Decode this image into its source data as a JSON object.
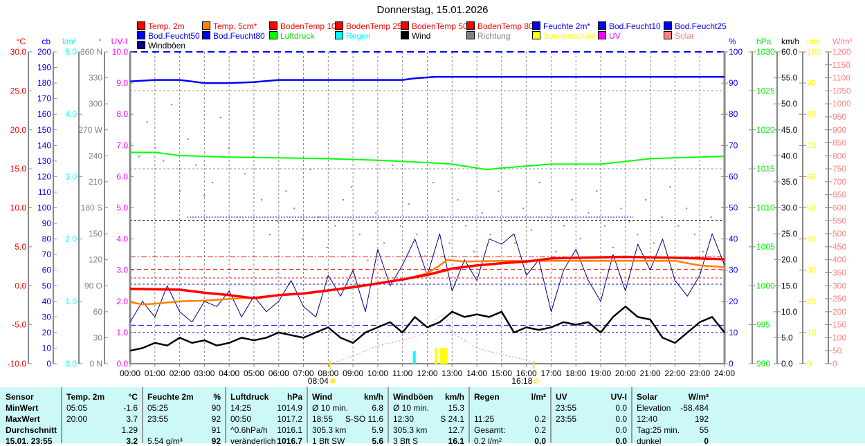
{
  "title": "Donnerstag, 15.01.2026",
  "legend": [
    {
      "label": "Temp. 2m",
      "color": "#ff0000",
      "text": "#ff0000"
    },
    {
      "label": "Temp. 5cm*",
      "color": "#ff8000",
      "text": "#ff0000"
    },
    {
      "label": "BodenTemp 10",
      "color": "#ff0000",
      "text": "#ff0000"
    },
    {
      "label": "BodenTemp 25",
      "color": "#ff0000",
      "text": "#ff0000"
    },
    {
      "label": "BodenTemp 50",
      "color": "#ff0000",
      "text": "#ff0000"
    },
    {
      "label": "BodenTemp 80",
      "color": "#ff0000",
      "text": "#ff0000"
    },
    {
      "label": "Feuchte 2m*",
      "color": "#0000ff",
      "text": "#0000ff"
    },
    {
      "label": "Bod.Feucht10",
      "color": "#0000ff",
      "text": "#0000ff"
    },
    {
      "label": "Bod.Feucht25",
      "color": "#0000ff",
      "text": "#0000ff"
    },
    {
      "label": "Bod.Feucht50",
      "color": "#0000ff",
      "text": "#0000ff"
    },
    {
      "label": "Bod.Feucht80",
      "color": "#0000ff",
      "text": "#0000ff"
    },
    {
      "label": "Luftdruck",
      "color": "#00ff00",
      "text": "#00dd00"
    },
    {
      "label": "Regen",
      "color": "#00ffff",
      "text": "#00ffff"
    },
    {
      "label": "Wind",
      "color": "#000000",
      "text": "#000000"
    },
    {
      "label": "Richtung",
      "color": "#808080",
      "text": "#808080"
    },
    {
      "label": "Sonnenschein",
      "color": "#ffff00",
      "text": "#ffff00"
    },
    {
      "label": "UV",
      "color": "#ff00ff",
      "text": "#ff00ff"
    },
    {
      "label": "Solar",
      "color": "#ff8080",
      "text": "#ff8080"
    },
    {
      "label": "Windböen",
      "color": "#000080",
      "text": "#000000"
    }
  ],
  "chart_data": {
    "type": "line",
    "title": "Donnerstag, 15.01.2026",
    "x_labels": [
      "00:00",
      "01:00",
      "02:00",
      "03:00",
      "04:00",
      "05:00",
      "06:00",
      "07:00",
      "08:00",
      "09:00",
      "10:00",
      "11:00",
      "12:00",
      "13:00",
      "14:00",
      "15:00",
      "16:00",
      "17:00",
      "18:00",
      "19:00",
      "20:00",
      "21:00",
      "22:00",
      "23:00",
      "24:00"
    ],
    "sunrise": "08:04",
    "sunset": "16:18",
    "sunrise_h": 8.07,
    "sunset_h": 16.3,
    "axes": {
      "left": [
        {
          "unit": "°C",
          "color": "#ff0000",
          "min": -10,
          "max": 30,
          "labels": [
            "30.0",
            "25.0",
            "20.0",
            "15.0",
            "10.0",
            "5.0",
            "0.0",
            "-5.0",
            "-10.0"
          ]
        },
        {
          "unit": "cb",
          "color": "#0000ff",
          "min": 0,
          "max": 200,
          "labels": [
            "200",
            "190",
            "180",
            "170",
            "160",
            "150",
            "140",
            "130",
            "120",
            "110",
            "100",
            "90",
            "80",
            "70",
            "60",
            "50",
            "40",
            "30",
            "20",
            "10",
            "0"
          ]
        },
        {
          "unit": "l/m²",
          "color": "#00ffff",
          "min": 0,
          "max": 5,
          "labels": [
            "5.0",
            "4.0",
            "3.0",
            "2.0",
            "1.0",
            "0.0"
          ]
        },
        {
          "unit": "°",
          "color": "#808080",
          "min": 0,
          "max": 360,
          "labels": [
            "360 N",
            "330",
            "300",
            "270 W",
            "240",
            "210",
            "180 S",
            "150",
            "120",
            "90 O",
            "60",
            "30",
            "0 N"
          ]
        },
        {
          "unit": "UV-I",
          "color": "#ff00ff",
          "min": 0,
          "max": 10,
          "labels": [
            "10.0",
            "9.0",
            "8.0",
            "7.0",
            "6.0",
            "5.0",
            "4.0",
            "3.0",
            "2.0",
            "1.0",
            "0.0"
          ]
        }
      ],
      "right": [
        {
          "unit": "%",
          "color": "#0000ff",
          "min": 0,
          "max": 100,
          "labels": [
            "100",
            "90",
            "80",
            "70",
            "60",
            "50",
            "40",
            "30",
            "20",
            "10",
            "0"
          ]
        },
        {
          "unit": "hPa",
          "color": "#00ee00",
          "min": 990,
          "max": 1030,
          "labels": [
            "1030",
            "1025",
            "1020",
            "1015",
            "1010",
            "1005",
            "1000",
            "995",
            "990"
          ]
        },
        {
          "unit": "km/h",
          "color": "#000000",
          "min": 0,
          "max": 60,
          "labels": [
            "60.0",
            "55.0",
            "50.0",
            "45.0",
            "40.0",
            "35.0",
            "30.0",
            "25.0",
            "20.0",
            "15.0",
            "10.0",
            "5.0",
            "0.0"
          ]
        },
        {
          "unit": "min",
          "color": "#ffff00",
          "min": 0,
          "max": 100,
          "labels": [
            "100",
            "90",
            "80",
            "70",
            "60",
            "50",
            "40",
            "30",
            "20",
            "10",
            "0"
          ]
        },
        {
          "unit": "W/m²",
          "color": "#ff8080",
          "min": 0,
          "max": 1200,
          "labels": [
            "1200",
            "1150",
            "1100",
            "1050",
            "1000",
            "950",
            "900",
            "850",
            "800",
            "750",
            "700",
            "650",
            "600",
            "550",
            "500",
            "450",
            "400",
            "350",
            "300",
            "250",
            "200",
            "150",
            "100",
            "50",
            "0"
          ]
        }
      ]
    },
    "series": [
      {
        "name": "Luftdruck",
        "axis": "hPa",
        "color": "#00ff00",
        "width": 2,
        "points": [
          [
            0,
            1017.1
          ],
          [
            1,
            1017.1
          ],
          [
            2,
            1016.7
          ],
          [
            3,
            1016.6
          ],
          [
            4,
            1016.5
          ],
          [
            6,
            1016.4
          ],
          [
            8,
            1016.3
          ],
          [
            10,
            1016.1
          ],
          [
            12,
            1015.8
          ],
          [
            13,
            1015.6
          ],
          [
            14.4,
            1014.9
          ],
          [
            15,
            1015.1
          ],
          [
            17,
            1015.6
          ],
          [
            19,
            1015.6
          ],
          [
            21,
            1016.3
          ],
          [
            22,
            1016.4
          ],
          [
            24,
            1016.6
          ]
        ]
      },
      {
        "name": "Feuchte 2m",
        "axis": "%",
        "color": "#0000ff",
        "width": 2.5,
        "points": [
          [
            0,
            90.5
          ],
          [
            1,
            91
          ],
          [
            2,
            91
          ],
          [
            3,
            90
          ],
          [
            4,
            90
          ],
          [
            5,
            90.3
          ],
          [
            6,
            91
          ],
          [
            10,
            91
          ],
          [
            11,
            91
          ],
          [
            11.5,
            91.5
          ],
          [
            12.3,
            92
          ],
          [
            24,
            92
          ]
        ]
      },
      {
        "name": "Windböen",
        "axis": "km/h",
        "color": "#000080",
        "width": 1,
        "step": 0.5,
        "values": [
          8,
          12,
          9,
          15,
          10,
          8,
          12,
          11,
          14,
          9,
          13,
          10,
          12,
          16,
          11,
          9,
          17,
          13,
          18,
          10,
          22,
          15,
          19,
          24,
          17,
          25,
          14,
          20,
          16,
          24,
          23,
          25,
          17,
          20,
          10,
          18,
          22,
          16,
          12,
          21,
          14,
          23,
          18,
          24,
          16,
          13,
          17,
          25,
          19
        ]
      },
      {
        "name": "Wind",
        "axis": "km/h",
        "color": "#000000",
        "width": 2.5,
        "step": 0.5,
        "values": [
          2.5,
          3,
          4,
          3.5,
          5,
          4,
          4.5,
          3.5,
          4,
          5,
          4.5,
          5,
          6,
          5.5,
          5,
          6,
          7,
          5,
          4,
          6,
          7,
          8,
          6,
          9,
          7,
          8,
          10,
          9,
          9.5,
          9,
          10,
          6,
          7,
          6.5,
          7,
          8,
          7.5,
          8,
          6,
          9,
          11,
          9,
          8.5,
          5,
          4,
          6,
          8,
          9,
          6
        ]
      },
      {
        "name": "Temp. 5cm",
        "axis": "°C",
        "color": "#ff8000",
        "width": 2.5,
        "points": [
          [
            0,
            -2.1
          ],
          [
            0.5,
            -2.4
          ],
          [
            1,
            -2.3
          ],
          [
            2,
            -2.0
          ],
          [
            3,
            -1.9
          ],
          [
            4,
            -1.7
          ],
          [
            5,
            -1.5
          ],
          [
            6,
            -1.2
          ],
          [
            7,
            -1.0
          ],
          [
            8,
            -0.6
          ],
          [
            9,
            -0.1
          ],
          [
            10,
            0.3
          ],
          [
            11,
            0.8
          ],
          [
            12,
            1.6
          ],
          [
            12.5,
            2.6
          ],
          [
            12.8,
            3.3
          ],
          [
            13.5,
            3.1
          ],
          [
            15,
            3.2
          ],
          [
            18,
            3.2
          ],
          [
            20,
            3.2
          ],
          [
            22,
            3.2
          ],
          [
            22.5,
            2.9
          ],
          [
            23,
            2.6
          ],
          [
            24,
            2.4
          ]
        ]
      },
      {
        "name": "Temp. 2m",
        "axis": "°C",
        "color": "#ff0000",
        "width": 3.5,
        "points": [
          [
            0,
            -0.4
          ],
          [
            2,
            -0.5
          ],
          [
            3,
            -0.9
          ],
          [
            4,
            -1.2
          ],
          [
            5,
            -1.6
          ],
          [
            6,
            -1.2
          ],
          [
            7,
            -1.0
          ],
          [
            8,
            -0.6
          ],
          [
            9,
            -0.2
          ],
          [
            10,
            0.3
          ],
          [
            11,
            0.8
          ],
          [
            12,
            1.4
          ],
          [
            12.5,
            1.8
          ],
          [
            13,
            2.2
          ],
          [
            14,
            2.6
          ],
          [
            15,
            2.9
          ],
          [
            16,
            3.1
          ],
          [
            17,
            3.5
          ],
          [
            18,
            3.6
          ],
          [
            20,
            3.7
          ],
          [
            22,
            3.6
          ],
          [
            23,
            3.5
          ],
          [
            24,
            3.4
          ]
        ]
      }
    ],
    "solar": {
      "axis": "W/m²",
      "color": "#ff8080",
      "points": [
        [
          8.07,
          0
        ],
        [
          9,
          30
        ],
        [
          10,
          70
        ],
        [
          11,
          90
        ],
        [
          12,
          120
        ],
        [
          12.3,
          170
        ],
        [
          12.67,
          192
        ],
        [
          13,
          120
        ],
        [
          14,
          60
        ],
        [
          15,
          35
        ],
        [
          16,
          15
        ],
        [
          16.3,
          0
        ]
      ]
    },
    "sunshine": {
      "axis": "min",
      "color": "#ffff00",
      "points": [
        [
          12.3,
          5
        ],
        [
          12.5,
          5
        ],
        [
          12.6,
          5
        ],
        [
          12.7,
          5
        ]
      ]
    },
    "rain": {
      "axis": "l/m²",
      "color": "#00ffff",
      "points": [
        [
          11.42,
          0.2
        ]
      ]
    },
    "direction": {
      "axis": "°",
      "color": "#808080",
      "step": 0.33,
      "values": [
        255,
        240,
        280,
        250,
        235,
        300,
        200,
        260,
        230,
        195,
        210,
        285,
        250,
        170,
        220,
        240,
        190,
        150,
        165,
        200,
        180,
        145,
        225,
        170,
        135,
        160,
        190,
        205,
        150,
        120,
        175,
        140,
        230,
        160,
        185,
        150,
        125,
        210,
        170,
        140,
        190,
        160,
        130,
        175,
        150,
        200,
        165,
        140,
        180,
        155,
        210,
        170,
        130,
        160,
        190,
        145,
        175,
        200,
        160,
        135,
        180,
        165,
        150,
        190,
        140,
        170,
        205,
        160,
        180,
        150,
        130,
        170
      ]
    },
    "reference_lines": [
      {
        "axis": "%",
        "value": 87.5,
        "color": "#808080",
        "dash": "3,3"
      },
      {
        "axis": "%",
        "value": 62.5,
        "color": "#808080",
        "dash": "3,3"
      },
      {
        "axis": "%",
        "value": 46,
        "color": "#000000",
        "dash": "3,3"
      },
      {
        "axis": "°C",
        "value": 3.7,
        "color": "#ff0000",
        "dash": "8,3,2,3"
      },
      {
        "axis": "°C",
        "value": 2.1,
        "color": "#ff0000",
        "dash": "6,4"
      },
      {
        "axis": "°C",
        "value": 1.0,
        "color": "#ff0000",
        "dash": "3,3"
      },
      {
        "axis": "km/h",
        "value": 15.3,
        "color": "#0000ff",
        "dash": "3,3"
      },
      {
        "axis": "km/h",
        "value": 7.4,
        "color": "#0000ff",
        "dash": "8,4"
      },
      {
        "axis": "km/h",
        "value": 6.0,
        "color": "#0000ff",
        "dash": "3,3"
      },
      {
        "axis": "%",
        "value": 100,
        "color": "#0000ff",
        "dash": "10,6"
      }
    ]
  },
  "table": [
    {
      "h": [
        "Sensor",
        ""
      ],
      "rows": [
        [
          "MinWert",
          ""
        ],
        [
          "MaxWert",
          ""
        ],
        [
          "Durchschnitt",
          ""
        ],
        [
          "15.01. 23:55",
          ""
        ]
      ],
      "bold": true
    },
    {
      "h": [
        "Temp. 2m",
        "°C"
      ],
      "rows": [
        [
          "05:05",
          "-1.6"
        ],
        [
          "20:00",
          "3.7"
        ],
        [
          "",
          "1.29"
        ],
        [
          "",
          "3.2"
        ]
      ]
    },
    {
      "h": [
        "Feuchte 2m",
        "%"
      ],
      "rows": [
        [
          "05:25",
          "90"
        ],
        [
          "23:55",
          "92"
        ],
        [
          "",
          "91"
        ],
        [
          "5.54 g/m³",
          "92"
        ]
      ]
    },
    {
      "h": [
        "Luftdruck",
        "hPa"
      ],
      "rows": [
        [
          "14:25",
          "1014.9"
        ],
        [
          "00:50",
          "1017.2"
        ],
        [
          "^0.6hPa/h",
          "1016.1"
        ],
        [
          "veränderlich",
          "1016.7"
        ]
      ]
    },
    {
      "h": [
        "Wind",
        "km/h"
      ],
      "rows": [
        [
          "Ø 10 min.",
          "6.8"
        ],
        [
          "18:55",
          "S-SO 11.6"
        ],
        [
          "305.3 km",
          "5.9"
        ],
        [
          "1 Bft SW",
          "5.6"
        ]
      ]
    },
    {
      "h": [
        "Windböen",
        "km/h"
      ],
      "rows": [
        [
          "Ø 10 min.",
          "15.3"
        ],
        [
          "12:30",
          "S 24.1"
        ],
        [
          "305.3 km",
          "12.7"
        ],
        [
          "3 Bft S",
          "16.1"
        ]
      ]
    },
    {
      "h": [
        "Regen",
        "l/m²"
      ],
      "rows": [
        [
          "",
          ""
        ],
        [
          "11:25",
          "0.2"
        ],
        [
          "Gesamt:",
          "0.2"
        ],
        [
          "0.2 l/m²",
          "0.0"
        ]
      ]
    },
    {
      "h": [
        "UV",
        "UV-I"
      ],
      "rows": [
        [
          "23:55",
          "0.0"
        ],
        [
          "23:55",
          "0.0"
        ],
        [
          "",
          "0.0"
        ],
        [
          "",
          "0.0"
        ]
      ]
    },
    {
      "h": [
        "Solar",
        "W/m²"
      ],
      "rows": [
        [
          "Elevation",
          "-58.484"
        ],
        [
          "12:40",
          "192"
        ],
        [
          "Tag:25 min.",
          "55"
        ],
        [
          "dunkel",
          "0"
        ]
      ]
    }
  ]
}
